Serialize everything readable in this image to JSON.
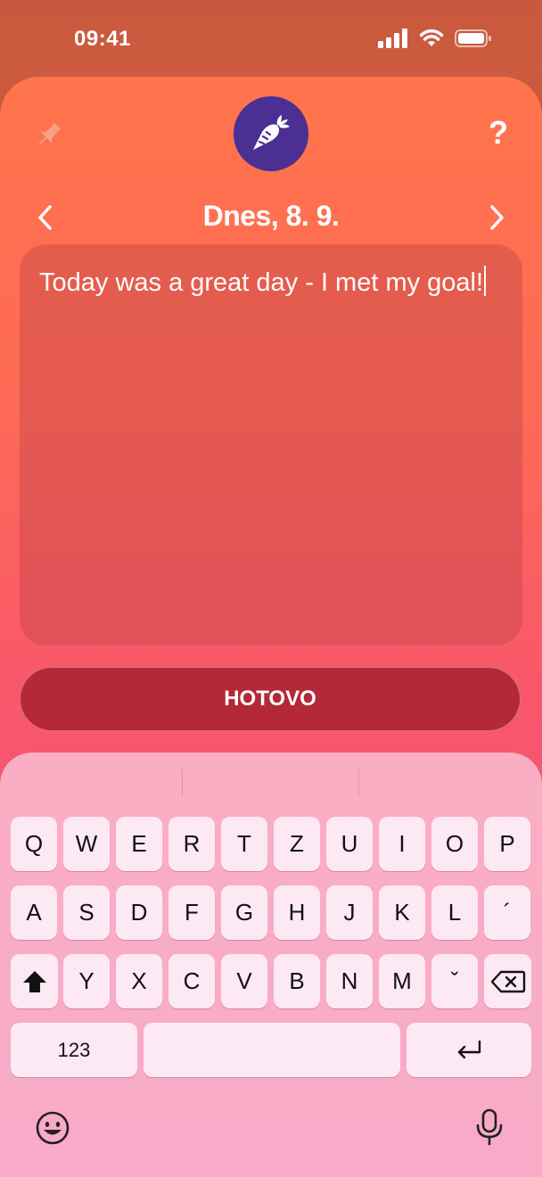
{
  "status_bar": {
    "time": "09:41",
    "icons": [
      "cellular-signal-icon",
      "wifi-icon",
      "battery-icon"
    ]
  },
  "header": {
    "pin_icon": "pin-icon",
    "logo_icon": "carrot-icon",
    "help_label": "?"
  },
  "date_nav": {
    "title": "Dnes, 8. 9.",
    "prev_icon": "chevron-left-icon",
    "next_icon": "chevron-right-icon"
  },
  "note": {
    "text": "Today was a great day - I met my goal!"
  },
  "done_button": {
    "label": "HOTOVO"
  },
  "keyboard": {
    "row1": [
      "Q",
      "W",
      "E",
      "R",
      "T",
      "Z",
      "U",
      "I",
      "O",
      "P"
    ],
    "row2": [
      "A",
      "S",
      "D",
      "F",
      "G",
      "H",
      "J",
      "K",
      "L",
      "´"
    ],
    "row3": [
      "Y",
      "X",
      "C",
      "V",
      "B",
      "N",
      "M",
      "ˇ"
    ],
    "numbers_label": "123",
    "shift_icon": "shift-icon",
    "backspace_icon": "backspace-icon",
    "return_icon": "return-icon",
    "emoji_icon": "emoji-icon",
    "mic_icon": "microphone-icon"
  },
  "colors": {
    "accent_purple": "#4b2f93",
    "done_red": "#b42838",
    "status_bar_bg": "#c9583e"
  }
}
